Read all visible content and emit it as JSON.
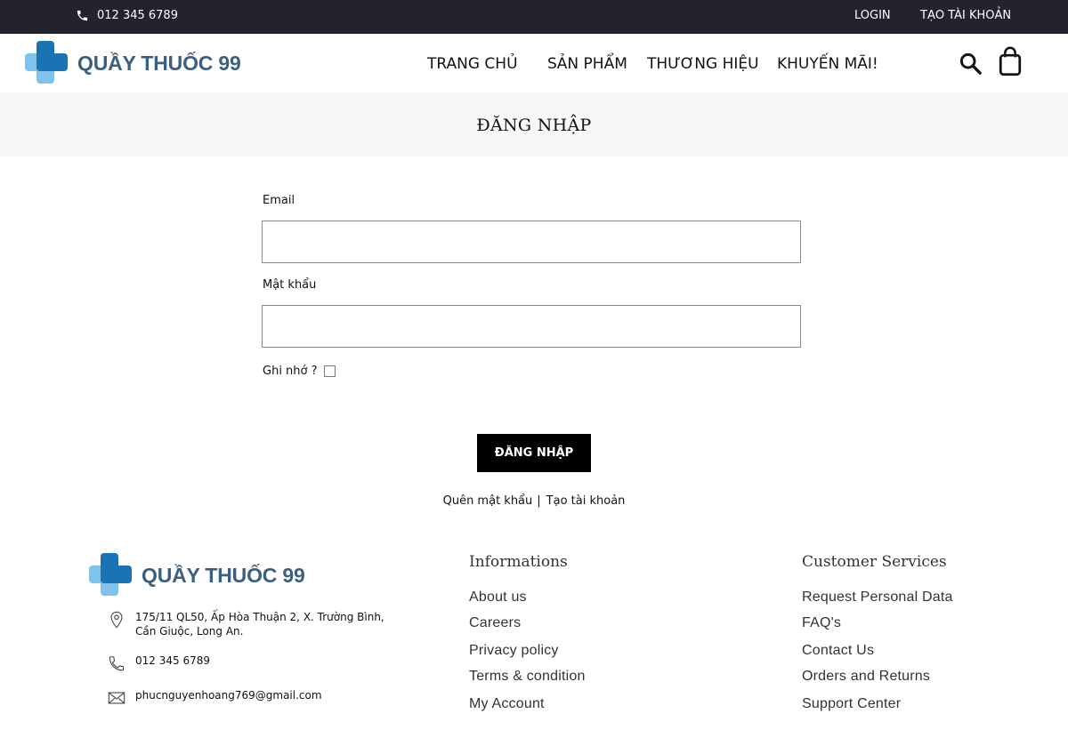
{
  "topbar": {
    "phone": "012 345 6789",
    "login": "LOGIN",
    "register": "TẠO TÀI KHOẢN"
  },
  "brand": {
    "name": "QUẦY THUỐC 99",
    "color": "#3c5f7f",
    "icon": "medical-cross-logo-icon"
  },
  "nav": {
    "home": "TRANG CHỦ",
    "products": "SẢN PHẨM",
    "brands": "THƯƠNG HIỆU",
    "promotions": "KHUYẾN MÃI!"
  },
  "header_icons": {
    "search": "search-icon",
    "cart": "shopping-bag-icon"
  },
  "page": {
    "title": "ĐĂNG NHẬP"
  },
  "form": {
    "email_label": "Email",
    "email_value": "",
    "password_label": "Mật khẩu",
    "password_value": "",
    "remember_label": "Ghi nhớ ?",
    "remember_checked": false,
    "submit": "ĐĂNG NHẬP",
    "forgot": "Quên mật khẩu",
    "separator": "|",
    "create_account": "Tạo tài khoản"
  },
  "footer": {
    "address": "175/11 QL50, Ấp Hòa Thuận 2, X. Trường Bình, Cần Giuộc, Long An.",
    "phone": "012 345 6789",
    "email": "phucnguyenhoang769@gmail.com",
    "informations": {
      "heading": "Informations",
      "links": [
        "About us",
        "Careers",
        "Privacy policy",
        "Terms & condition",
        "My Account"
      ]
    },
    "customer_services": {
      "heading": "Customer Services",
      "links": [
        "Request Personal Data",
        "FAQ's",
        "Contact Us",
        "Orders and Returns",
        "Support Center"
      ]
    }
  }
}
